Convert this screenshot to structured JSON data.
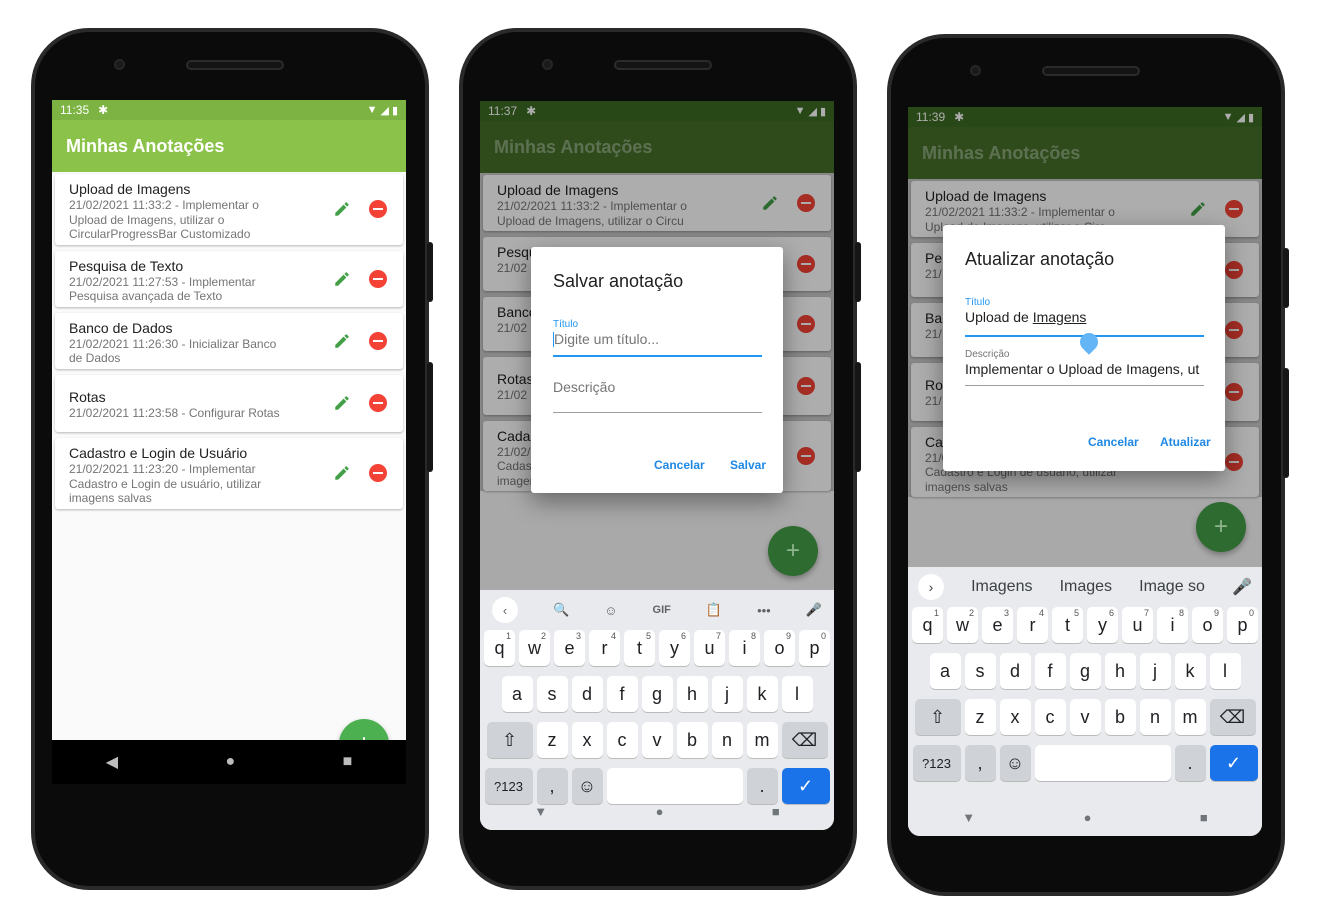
{
  "phone1": {
    "status": {
      "time": "11:35"
    },
    "appbar": {
      "title": "Minhas Anotações",
      "color": "#8bc34a"
    },
    "notes": [
      {
        "title": "Upload de Imagens",
        "sub": "21/02/2021 11:33:2 - Implementar o Upload de Imagens, utilizar o CircularProgressBar Customizado"
      },
      {
        "title": "Pesquisa de Texto",
        "sub": "21/02/2021 11:27:53 - Implementar Pesquisa avançada de Texto"
      },
      {
        "title": "Banco de Dados",
        "sub": "21/02/2021 11:26:30 - Inicializar Banco de Dados"
      },
      {
        "title": "Rotas",
        "sub": "21/02/2021 11:23:58 - Configurar Rotas"
      },
      {
        "title": "Cadastro e Login de Usuário",
        "sub": "21/02/2021 11:23:20 - Implementar Cadastro e Login de usuário, utilizar imagens salvas"
      }
    ],
    "fab": "+"
  },
  "phone2": {
    "status": {
      "time": "11:37"
    },
    "appbar": {
      "title": "Minhas Anotações"
    },
    "notes": [
      {
        "title": "Upload de Imagens",
        "sub": "21/02/2021 11:33:2 - Implementar o Upload de Imagens, utilizar o Circu"
      },
      {
        "title": "Pesqu",
        "sub": "21/02 Pesqu"
      },
      {
        "title": "Banco",
        "sub": "21/02 Dados"
      },
      {
        "title": "Rotas",
        "sub": "21/02"
      },
      {
        "title": "Cadas",
        "sub": "21/02/2021 11:23:20 - Implementar Cadastro e Login de usuário, utilizar imagens salvas"
      }
    ],
    "dialog": {
      "title": "Salvar anotação",
      "field1_label": "Título",
      "field1_placeholder": "Digite um título...",
      "field2_placeholder": "Descrição",
      "cancel": "Cancelar",
      "ok": "Salvar"
    },
    "keyboard": {
      "toolbar": [
        "‹",
        "🔍",
        "☺",
        "GIF",
        "📋",
        "•••",
        "🎤"
      ],
      "row1": [
        "q",
        "w",
        "e",
        "r",
        "t",
        "y",
        "u",
        "i",
        "o",
        "p"
      ],
      "row1_sup": [
        "1",
        "2",
        "3",
        "4",
        "5",
        "6",
        "7",
        "8",
        "9",
        "0"
      ],
      "row2": [
        "a",
        "s",
        "d",
        "f",
        "g",
        "h",
        "j",
        "k",
        "l"
      ],
      "row3": [
        "z",
        "x",
        "c",
        "v",
        "b",
        "n",
        "m"
      ],
      "symbols": "?123",
      "comma": ",",
      "period": "."
    }
  },
  "phone3": {
    "status": {
      "time": "11:39"
    },
    "appbar": {
      "title": "Minhas Anotações"
    },
    "notes": [
      {
        "title": "Upload de Imagens",
        "sub": "21/02/2021 11:33:2 - Implementar o Upload de Imagens, utilizar o Circ"
      },
      {
        "title": "Pe",
        "sub": "21/ Pes"
      },
      {
        "title": "Ba",
        "sub": "21/ Dad"
      },
      {
        "title": "Ro",
        "sub": "21/"
      },
      {
        "title": "Ca",
        "sub": "21/02/2021 11:23:20 - Implementar Cadastro e Login de usuário, utilizar imagens salvas"
      }
    ],
    "dialog": {
      "title": "Atualizar anotação",
      "field1_label": "Título",
      "field1_value_a": "Upload de ",
      "field1_value_b": "Imagens",
      "field2_label": "Descrição",
      "field2_value": "Implementar o Upload de Imagens, ut",
      "cancel": "Cancelar",
      "ok": "Atualizar"
    },
    "keyboard": {
      "suggestions": [
        "Imagens",
        "Images",
        "Image so"
      ],
      "row1": [
        "q",
        "w",
        "e",
        "r",
        "t",
        "y",
        "u",
        "i",
        "o",
        "p"
      ],
      "row1_sup": [
        "1",
        "2",
        "3",
        "4",
        "5",
        "6",
        "7",
        "8",
        "9",
        "0"
      ],
      "row2": [
        "a",
        "s",
        "d",
        "f",
        "g",
        "h",
        "j",
        "k",
        "l"
      ],
      "row3": [
        "z",
        "x",
        "c",
        "v",
        "b",
        "n",
        "m"
      ],
      "symbols": "?123",
      "comma": ",",
      "period": "."
    }
  },
  "colors": {
    "green_light": "#8bc34a",
    "green_dark": "#4a7a2a",
    "fab": "#4caf50",
    "delete": "#f44336",
    "accent": "#2196f3"
  }
}
